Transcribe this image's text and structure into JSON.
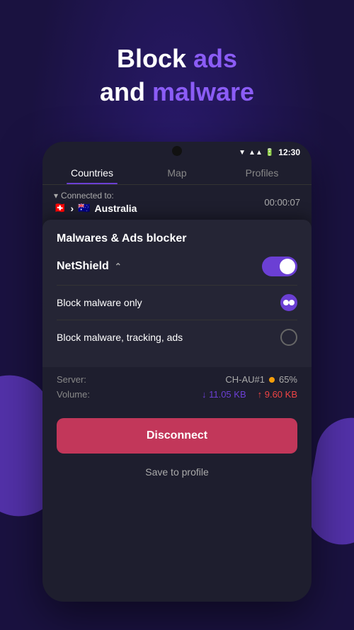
{
  "hero": {
    "line1_plain": "Block ",
    "line1_highlight": "ads",
    "line2_plain": "and ",
    "line2_highlight": "malware"
  },
  "status_bar": {
    "time": "12:30"
  },
  "tabs": [
    {
      "id": "countries",
      "label": "Countries",
      "active": true
    },
    {
      "id": "map",
      "label": "Map",
      "active": false
    },
    {
      "id": "profiles",
      "label": "Profiles",
      "active": false
    }
  ],
  "connected": {
    "label": "Connected to:",
    "flag_from": "🇨🇭",
    "arrow": "›",
    "flag_to": "🇦🇺",
    "country": "Australia",
    "time": "00:00:07"
  },
  "popup": {
    "title": "Malwares & Ads blocker",
    "netshield_label": "NetShield",
    "toggle_on": true,
    "options": [
      {
        "label": "Block malware only",
        "selected": true
      },
      {
        "label": "Block malware, tracking, ads",
        "selected": false
      }
    ]
  },
  "server": {
    "label": "Server:",
    "value": "CH-AU#1",
    "load": "65%",
    "volume_label": "Volume:",
    "download": "↓ 11.05 KB",
    "upload": "↑ 9.60 KB"
  },
  "actions": {
    "disconnect": "Disconnect",
    "save_profile": "Save to profile"
  }
}
